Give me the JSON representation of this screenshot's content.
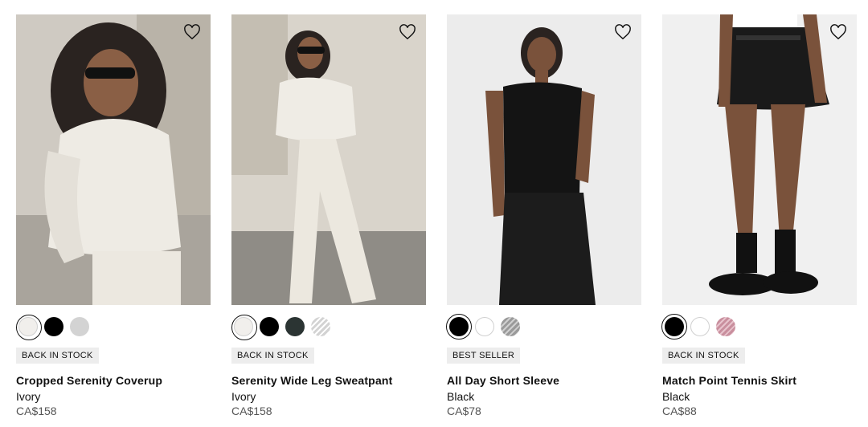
{
  "products": [
    {
      "badge": "BACK IN STOCK",
      "name": "Cropped Serenity Coverup",
      "color": "Ivory",
      "price": "CA$158",
      "swatches": [
        {
          "color": "#f1efec",
          "selected": true,
          "striped": false
        },
        {
          "color": "#000000",
          "selected": false,
          "striped": false
        },
        {
          "color": "#d3d3d3",
          "selected": false,
          "striped": false
        }
      ]
    },
    {
      "badge": "BACK IN STOCK",
      "name": "Serenity Wide Leg Sweatpant",
      "color": "Ivory",
      "price": "CA$158",
      "swatches": [
        {
          "color": "#f1efec",
          "selected": true,
          "striped": false
        },
        {
          "color": "#000000",
          "selected": false,
          "striped": false
        },
        {
          "color": "#2b3433",
          "selected": false,
          "striped": false
        },
        {
          "color": "#d3d3d3",
          "selected": false,
          "striped": true
        }
      ]
    },
    {
      "badge": "BEST SELLER",
      "name": "All Day Short Sleeve",
      "color": "Black",
      "price": "CA$78",
      "swatches": [
        {
          "color": "#000000",
          "selected": true,
          "striped": false
        },
        {
          "color": "#ffffff",
          "selected": false,
          "striped": false
        },
        {
          "color": "#9a9a9a",
          "selected": false,
          "striped": true
        }
      ]
    },
    {
      "badge": "BACK IN STOCK",
      "name": "Match Point Tennis Skirt",
      "color": "Black",
      "price": "CA$88",
      "swatches": [
        {
          "color": "#000000",
          "selected": true,
          "striped": false
        },
        {
          "color": "#ffffff",
          "selected": false,
          "striped": false
        },
        {
          "color": "#c98f9e",
          "selected": false,
          "striped": true
        }
      ]
    }
  ],
  "icons": {
    "wishlist": "heart-outline-icon"
  }
}
